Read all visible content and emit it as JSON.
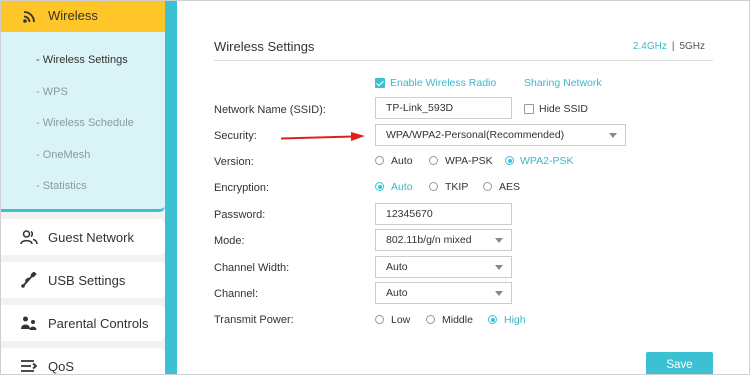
{
  "sidebar": {
    "wireless": {
      "label": "Wireless",
      "icon": "wifi-icon"
    },
    "subitems": [
      {
        "label": "- Wireless Settings",
        "active": true
      },
      {
        "label": "- WPS",
        "active": false
      },
      {
        "label": "- Wireless Schedule",
        "active": false
      },
      {
        "label": "- OneMesh",
        "active": false
      },
      {
        "label": "- Statistics",
        "active": false
      }
    ],
    "items": [
      {
        "label": "Guest Network",
        "icon": "guest-users-icon"
      },
      {
        "label": "USB Settings",
        "icon": "usb-icon"
      },
      {
        "label": "Parental Controls",
        "icon": "parental-controls-icon"
      },
      {
        "label": "QoS",
        "icon": "qos-icon"
      }
    ]
  },
  "main": {
    "title": "Wireless Settings",
    "band_24": "2.4GHz",
    "band_sep": "|",
    "band_5": "5GHz",
    "enable_radio": {
      "label": "Enable Wireless Radio",
      "checked": true
    },
    "sharing_network": "Sharing Network",
    "ssid": {
      "label": "Network Name (SSID):",
      "value": "TP-Link_593D",
      "hide_label": "Hide SSID",
      "hide_checked": false
    },
    "security": {
      "label": "Security:",
      "value": "WPA/WPA2-Personal(Recommended)"
    },
    "version": {
      "label": "Version:",
      "options": [
        "Auto",
        "WPA-PSK",
        "WPA2-PSK"
      ],
      "selected": "WPA2-PSK"
    },
    "encryption": {
      "label": "Encryption:",
      "options": [
        "Auto",
        "TKIP",
        "AES"
      ],
      "selected": "Auto"
    },
    "password": {
      "label": "Password:",
      "value": "12345670"
    },
    "mode": {
      "label": "Mode:",
      "value": "802.11b/g/n mixed"
    },
    "channel_width": {
      "label": "Channel Width:",
      "value": "Auto"
    },
    "channel": {
      "label": "Channel:",
      "value": "Auto"
    },
    "transmit_power": {
      "label": "Transmit Power:",
      "options": [
        "Low",
        "Middle",
        "High"
      ],
      "selected": "High"
    },
    "save_label": "Save"
  },
  "colors": {
    "accent": "#3bc1d3",
    "menu_highlight": "#ffc629",
    "submenu_bg": "#d9f3f6",
    "arrow": "#e02020"
  }
}
